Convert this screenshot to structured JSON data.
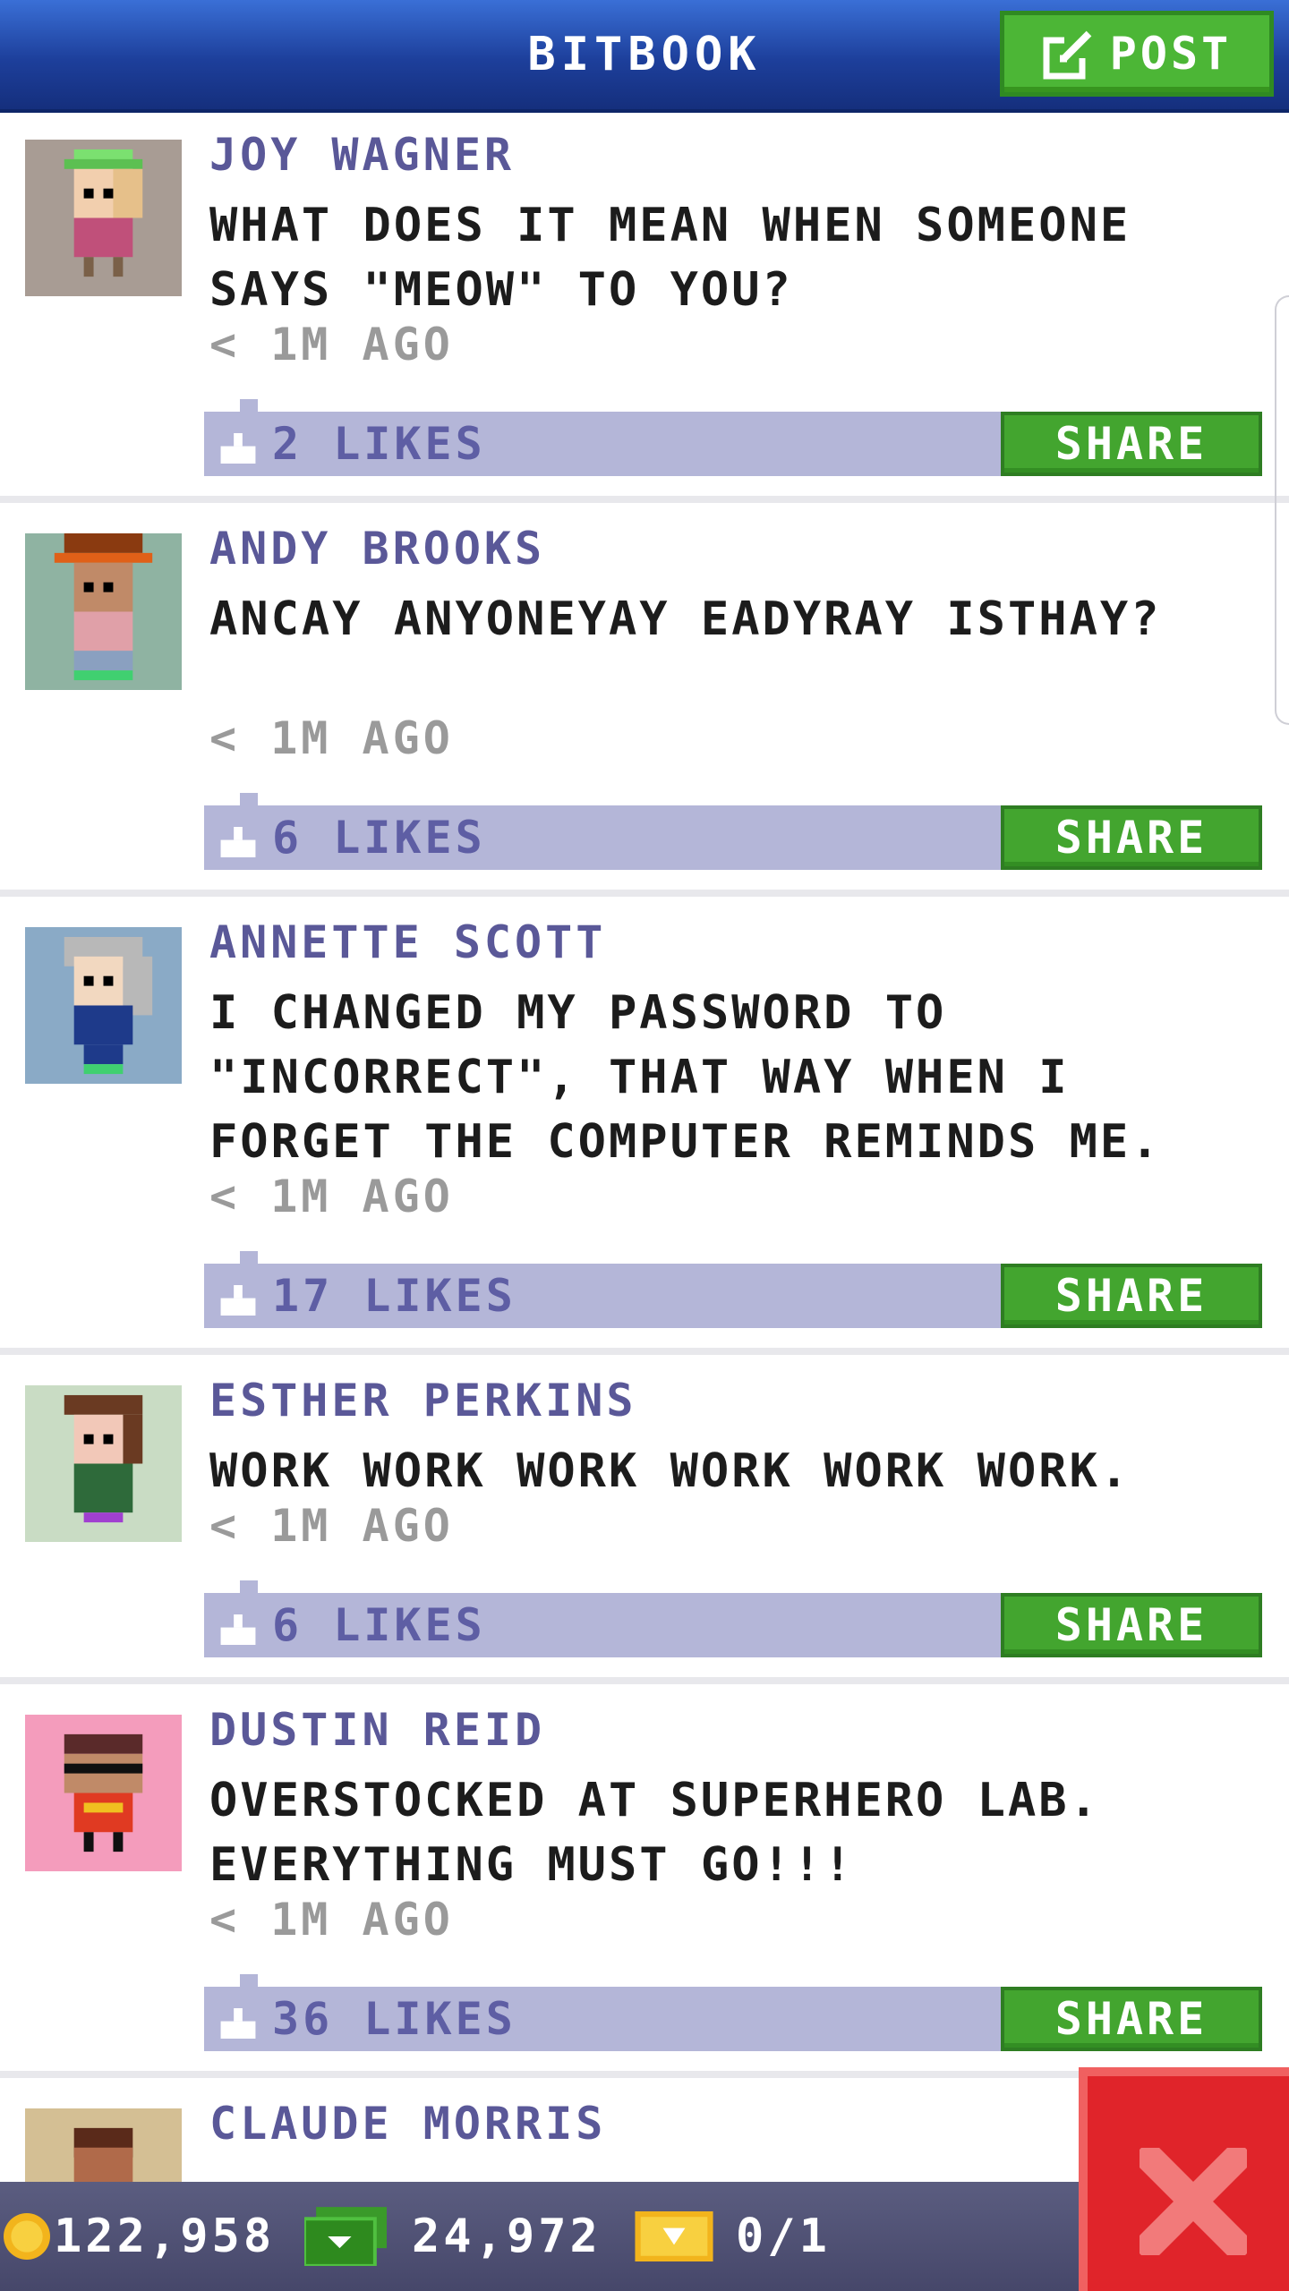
{
  "header": {
    "title": "BITBOOK",
    "post_label": "POST"
  },
  "posts": [
    {
      "author": "JOY WAGNER",
      "text": "WHAT DOES IT MEAN WHEN SOMEONE SAYS \"MEOW\" TO YOU?",
      "time": "< 1M AGO",
      "likes": "2 LIKES",
      "share": "SHARE",
      "avatar_bg": "#a89c94"
    },
    {
      "author": "ANDY BROOKS",
      "text": "ANCAY ANYONEYAY EADYRAY ISTHAY?",
      "time": "< 1M AGO",
      "likes": "6 LIKES",
      "share": "SHARE",
      "avatar_bg": "#8fb3a2"
    },
    {
      "author": "ANNETTE SCOTT",
      "text": "I CHANGED MY PASSWORD TO \"INCORRECT\", THAT WAY WHEN I FORGET THE COMPUTER REMINDS ME.",
      "time": "< 1M AGO",
      "likes": "17 LIKES",
      "share": "SHARE",
      "avatar_bg": "#8aaac6"
    },
    {
      "author": "ESTHER PERKINS",
      "text": "WORK WORK WORK WORK WORK WORK.",
      "time": "< 1M AGO",
      "likes": "6 LIKES",
      "share": "SHARE",
      "avatar_bg": "#c9dcc4"
    },
    {
      "author": "DUSTIN REID",
      "text": "OVERSTOCKED AT SUPERHERO LAB. EVERYTHING MUST GO!!!",
      "time": "< 1M AGO",
      "likes": "36 LIKES",
      "share": "SHARE",
      "avatar_bg": "#f49cbc"
    },
    {
      "author": "CLAUDE MORRIS",
      "avatar_bg": "#d4bf94"
    }
  ],
  "footer": {
    "coins": "122,958",
    "cash": "24,972",
    "tickets": "0/1"
  },
  "icons": {
    "post": "edit-icon",
    "like": "thumb-icon",
    "coin": "coin-icon",
    "cash": "cash-icon",
    "ticket": "ticket-icon",
    "close": "close-icon"
  },
  "colors": {
    "header": "#1d3f9b",
    "accent_green": "#43a52f",
    "likes_bar": "#b4b6d8",
    "author": "#5a5898",
    "close": "#e0242a"
  }
}
